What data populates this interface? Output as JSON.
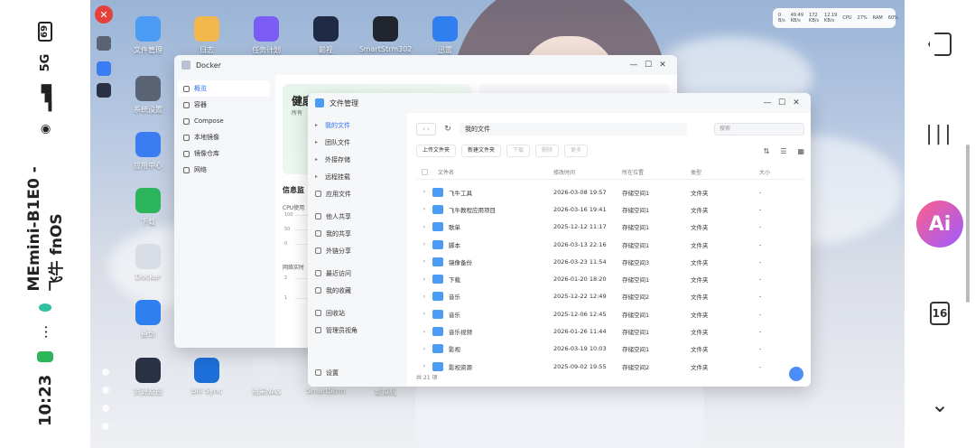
{
  "status": {
    "time": "10:23",
    "dots": "⋯",
    "title": "MEmini-B1E0 - 飞牛 fnOS",
    "network": "5G",
    "battery": "69"
  },
  "nav": {
    "calendar": "16",
    "ai": "Ai"
  },
  "desktop": {
    "icons": [
      {
        "label": "文件管理",
        "color": "#4c9bf5"
      },
      {
        "label": "日志",
        "color": "#f2b84b"
      },
      {
        "label": "任务计划",
        "color": "#7b5cf5"
      },
      {
        "label": "影视",
        "color": "#1f2a44"
      },
      {
        "label": "SmartStrm302",
        "color": "#20252e"
      },
      {
        "label": "迅雷",
        "color": "#2f7ff0"
      },
      {
        "label": "系统设置",
        "color": "#5b6475"
      },
      {
        "label": "应用中心",
        "color": "#3a7cf2"
      },
      {
        "label": "下载",
        "color": "#2db55d"
      },
      {
        "label": "Docker",
        "color": "#d8dde6"
      },
      {
        "label": "备份",
        "color": "#2f7ff0"
      },
      {
        "label": "资源监控",
        "color": "#2a3144"
      },
      {
        "label": "Bili Sync",
        "color": "#1c6fd8"
      },
      {
        "label": "海采NAS",
        "color": "#e7eaf0"
      },
      {
        "label": "SmartStrm",
        "color": "#4c9bf5"
      },
      {
        "label": "虚拟机",
        "color": "#5b6475"
      }
    ]
  },
  "sysmon": {
    "up": "0 B/s",
    "down": "49.49 KB/s",
    "up2": "172 KB/s",
    "down2": "12.19 KB/s",
    "cpu_label": "CPU",
    "cpu": "27%",
    "ram_label": "RAM",
    "ram": "60%"
  },
  "docker": {
    "title": "Docker",
    "nav": [
      "概览",
      "容器",
      "Compose",
      "本地镜像",
      "镜像仓库",
      "网络"
    ],
    "health_title": "健康",
    "health_sub": "所有",
    "info_title": "信息监",
    "cpu_label": "CPU使用",
    "net_label": "网络实时",
    "cpu_axis": [
      "100",
      "50",
      "0"
    ],
    "net_axis": [
      "2",
      "1"
    ]
  },
  "fm": {
    "title": "文件管理",
    "side": [
      {
        "label": "我的文件",
        "active": true,
        "caret": "▸"
      },
      {
        "label": "团队文件",
        "caret": "▸"
      },
      {
        "label": "外接存储",
        "caret": "▸"
      },
      {
        "label": "远程挂载",
        "caret": "▸"
      },
      {
        "label": "应用文件"
      },
      {
        "label": "他人共享"
      },
      {
        "label": "我的共享"
      },
      {
        "label": "外链分享"
      },
      {
        "label": "最近访问"
      },
      {
        "label": "我的收藏"
      },
      {
        "label": "回收站"
      },
      {
        "label": "管理员视角"
      }
    ],
    "settings": "设置",
    "path": "我的文件",
    "search_placeholder": "搜索",
    "toolbar": {
      "upload": "上传文件夹",
      "new_folder": "新建文件夹",
      "download": "下载",
      "delete": "删除",
      "more": "更多"
    },
    "columns": {
      "name": "文件名",
      "time": "修改时间",
      "loc": "所在位置",
      "type": "类型",
      "size": "大小"
    },
    "rows": [
      {
        "name": "飞牛工具",
        "time": "2026-03-08 19:57",
        "loc": "存储空间1",
        "type": "文件夹",
        "size": "-"
      },
      {
        "name": "飞牛教程应用项目",
        "time": "2026-03-16 19:41",
        "loc": "存储空间1",
        "type": "文件夹",
        "size": "-"
      },
      {
        "name": "歌单",
        "time": "2025-12-12 11:17",
        "loc": "存储空间1",
        "type": "文件夹",
        "size": "-"
      },
      {
        "name": "脚本",
        "time": "2026-03-13 22:16",
        "loc": "存储空间1",
        "type": "文件夹",
        "size": "-"
      },
      {
        "name": "镜像备份",
        "time": "2026-03-23 11:54",
        "loc": "存储空间3",
        "type": "文件夹",
        "size": "-"
      },
      {
        "name": "下载",
        "time": "2026-01-20 18:20",
        "loc": "存储空间1",
        "type": "文件夹",
        "size": "-"
      },
      {
        "name": "音乐",
        "time": "2025-12-22 12:49",
        "loc": "存储空间2",
        "type": "文件夹",
        "size": "-"
      },
      {
        "name": "音乐",
        "time": "2025-12-06 12:45",
        "loc": "存储空间1",
        "type": "文件夹",
        "size": "-"
      },
      {
        "name": "音乐视频",
        "time": "2026-01-26 11:44",
        "loc": "存储空间1",
        "type": "文件夹",
        "size": "-"
      },
      {
        "name": "影视",
        "time": "2026-03-19 10:03",
        "loc": "存储空间1",
        "type": "文件夹",
        "size": "-"
      },
      {
        "name": "影视资源",
        "time": "2025-09-02 19:55",
        "loc": "存储空间2",
        "type": "文件夹",
        "size": "-"
      }
    ],
    "footer": "共 21 项"
  }
}
